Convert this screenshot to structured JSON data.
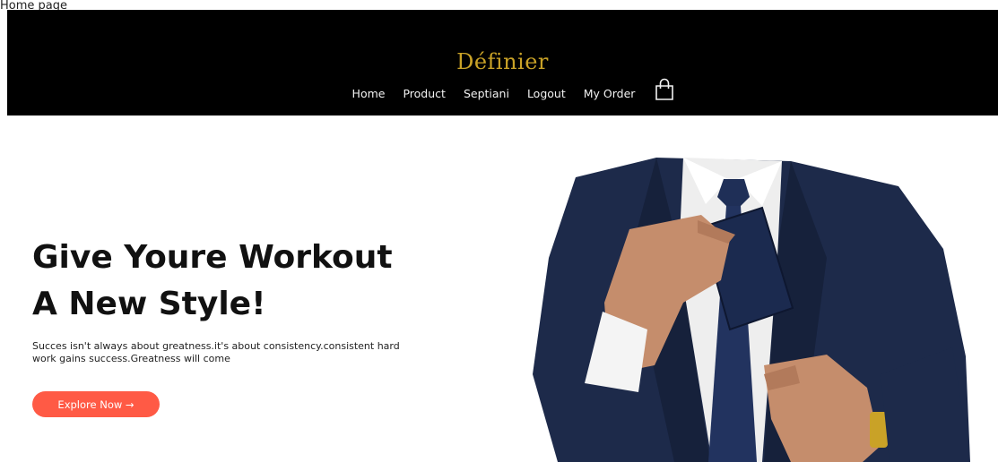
{
  "page_label": "Home page",
  "brand": {
    "name": "Définier",
    "color": "#c9a227"
  },
  "nav": {
    "items": [
      {
        "label": "Home"
      },
      {
        "label": "Product"
      },
      {
        "label": "Septiani"
      },
      {
        "label": "Logout"
      },
      {
        "label": "My Order"
      }
    ],
    "cart_icon": "shopping-bag-icon"
  },
  "hero": {
    "title_line1": "Give Youre Workout",
    "title_line2": "A New Style!",
    "text": "Succes isn't always about greatness.it's about consistency.consistent hard work gains success.Greatness will come",
    "cta_label": "Explore Now →",
    "cta_color": "#ff5a45"
  }
}
